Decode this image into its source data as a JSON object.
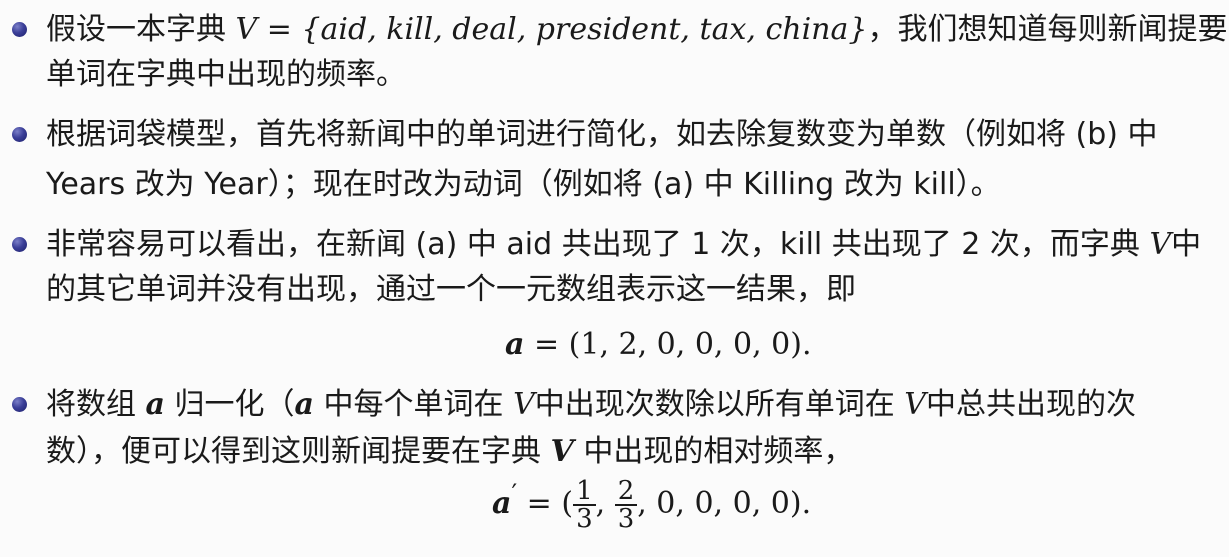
{
  "item1": {
    "l1_pre": "假设一本字典 ",
    "l1_math": "V = {aid, kill, deal, president, tax, china}",
    "l1_post": "，我们想知道每则新闻提要中的",
    "l2": "单词在字典中出现的频率。"
  },
  "item2": {
    "l1": "根据词袋模型，首先将新闻中的单词进行简化，如去除复数变为单数（例如将 (b) 中",
    "l2": "Years 改为 Year）；现在时改为动词（例如将 (a) 中 Killing 改为 kill）。"
  },
  "item3": {
    "l1_pre": "非常容易可以看出，在新闻 (a) 中 aid 共出现了 1 次，kill 共出现了 2 次，而字典 ",
    "l1_v": "V",
    "l1_post": "中",
    "l2": "的其它单词并没有出现，通过一个一元数组表示这一结果，即",
    "formula_a": "a",
    "formula_rest": " = (1, 2, 0, 0, 0, 0)."
  },
  "item4": {
    "l1_a": "将数组 ",
    "l1_av": "a",
    "l1_b": " 归一化（",
    "l1_av2": "a",
    "l1_c": " 中每个单词在 ",
    "l1_v": "V",
    "l1_d": "中出现次数除以所有单词在 ",
    "l1_v2": "V",
    "l1_e": "中总共出现的次",
    "l2_a": "数），便可以得到这则新闻提要在字典 ",
    "l2_v": "V",
    "l2_b": " 中出现的相对频率，",
    "formula_a": "a",
    "formula_prime": "′",
    "formula_eq": " = (",
    "frac1_num": "1",
    "frac1_den": "3",
    "comma": ", ",
    "frac2_num": "2",
    "frac2_den": "3",
    "formula_tail": ", 0, 0, 0, 0)."
  },
  "colors": {
    "bullet": "#3b3f98",
    "text": "#1a1a1a",
    "background": "#fbfbfb"
  }
}
